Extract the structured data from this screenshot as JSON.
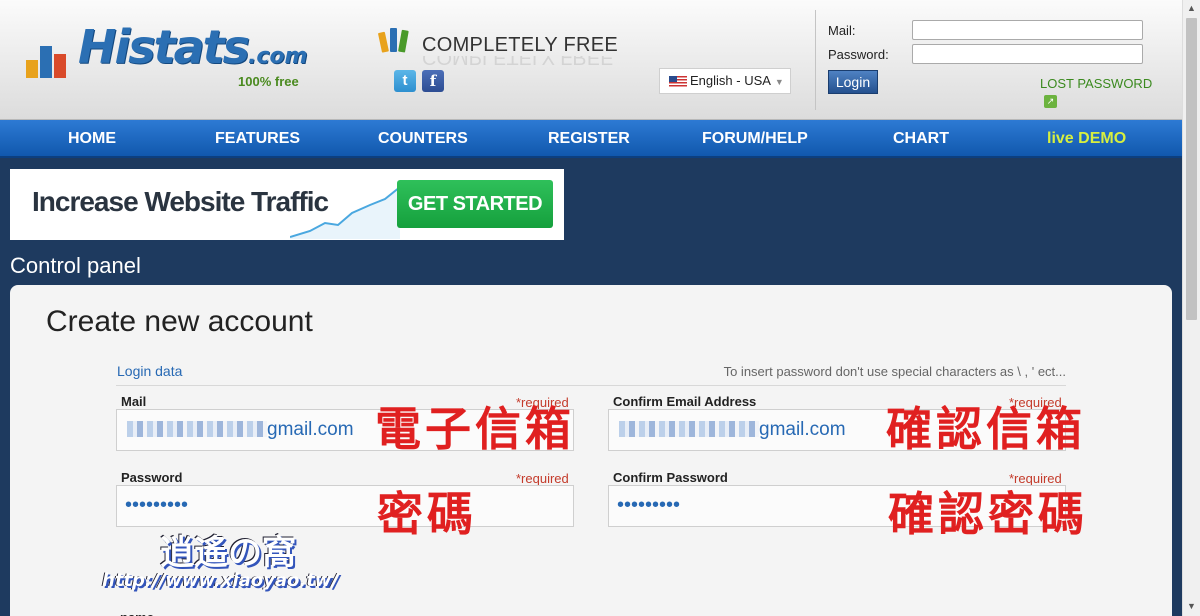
{
  "header": {
    "logo": {
      "word": "Histats",
      "suffix": ".com",
      "tagline": "100% free"
    },
    "badge": {
      "text": "COMPLETELY FREE"
    },
    "social": {
      "twitter": "t",
      "facebook": "f"
    },
    "language": {
      "selected": "English - USA"
    },
    "login": {
      "mail_label": "Mail:",
      "password_label": "Password:",
      "mail_value": "",
      "password_value": "",
      "button_label": "Login",
      "lost_password": "LOST PASSWORD"
    }
  },
  "nav": {
    "items": [
      {
        "label": "HOME"
      },
      {
        "label": "FEATURES"
      },
      {
        "label": "COUNTERS"
      },
      {
        "label": "REGISTER"
      },
      {
        "label": "FORUM/HELP"
      },
      {
        "label": "CHART"
      },
      {
        "label": "live DEMO"
      }
    ]
  },
  "banner": {
    "text": "Increase Website Traffic",
    "button": "GET STARTED"
  },
  "control_panel": {
    "title": "Control panel"
  },
  "form": {
    "title": "Create new account",
    "legend": "Login data",
    "hint": "To insert password don't use special characters as \\ , ' ect...",
    "required_tag": "*required",
    "mail": {
      "label": "Mail",
      "value_suffix": "gmail.com"
    },
    "confirm_mail": {
      "label": "Confirm Email Address",
      "value_suffix": "gmail.com"
    },
    "password": {
      "label": "Password",
      "value": "•••••••••"
    },
    "confirm_password": {
      "label": "Confirm Password",
      "value": "•••••••••"
    },
    "name_label": "name"
  },
  "annotations": {
    "mail": "電子信箱",
    "confirm_mail": "確認信箱",
    "password": "密碼",
    "confirm_password": "確認密碼"
  },
  "watermark": {
    "title": "逍遙の窩",
    "url": "http://www.xiaoyao.tw/"
  },
  "colors": {
    "nav": "#1a66c2",
    "page_bg": "#1e3a5f",
    "link_blue": "#2769b4",
    "required_red": "#c43b2b",
    "annotation_red": "#e02020",
    "banner_green": "#22b04a",
    "demo_yellow": "#d7ef3f"
  }
}
